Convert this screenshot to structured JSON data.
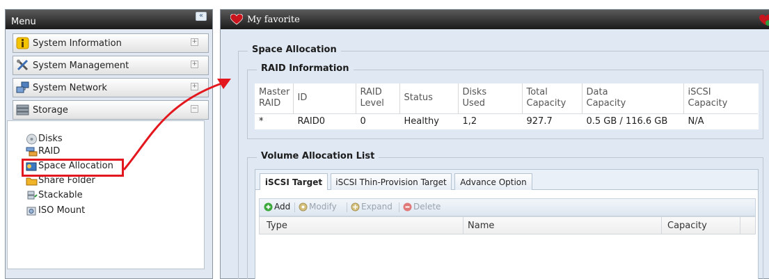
{
  "menu": {
    "title": "Menu",
    "collapse_glyph": "«",
    "categories": [
      {
        "label": "System Information",
        "toggle": "+",
        "icon": "info-icon"
      },
      {
        "label": "System Management",
        "toggle": "+",
        "icon": "tools-icon"
      },
      {
        "label": "System Network",
        "toggle": "+",
        "icon": "network-icon"
      },
      {
        "label": "Storage",
        "toggle": "−",
        "icon": "storage-icon"
      }
    ],
    "storage_items": [
      {
        "label": "Disks",
        "icon": "disk-icon"
      },
      {
        "label": "RAID",
        "icon": "raid-icon"
      },
      {
        "label": "Space Allocation",
        "icon": "space-allocation-icon"
      },
      {
        "label": "Share Folder",
        "icon": "folder-icon"
      },
      {
        "label": "Stackable",
        "icon": "stackable-icon"
      },
      {
        "label": "ISO Mount",
        "icon": "iso-mount-icon"
      }
    ],
    "highlighted_item": "Space Allocation",
    "highlight_color": "#e3171e"
  },
  "favorite": {
    "title": "My favorite",
    "icon": "heart-icon",
    "accent": "#c8141c"
  },
  "space_allocation": {
    "legend": "Space Allocation",
    "raid_info": {
      "legend": "RAID Information",
      "columns": [
        {
          "line1": "Master",
          "line2": "RAID"
        },
        {
          "line1": "ID",
          "line2": ""
        },
        {
          "line1": "RAID",
          "line2": "Level"
        },
        {
          "line1": "Status",
          "line2": ""
        },
        {
          "line1": "Disks",
          "line2": "Used"
        },
        {
          "line1": "Total",
          "line2": "Capacity"
        },
        {
          "line1": "Data",
          "line2": "Capacity"
        },
        {
          "line1": "iSCSI",
          "line2": "Capacity"
        }
      ],
      "rows": [
        [
          "*",
          "RAID0",
          "0",
          "Healthy",
          "1,2",
          "927.7",
          "0.5 GB / 116.6 GB",
          "N/A"
        ]
      ]
    },
    "volume_list": {
      "legend": "Volume Allocation List",
      "tabs": [
        "iSCSI Target",
        "iSCSI Thin-Provision Target",
        "Advance Option"
      ],
      "active_tab": "iSCSI Target",
      "toolbar": [
        {
          "label": "Add",
          "icon": "add-icon",
          "enabled": true
        },
        {
          "label": "Modify",
          "icon": "modify-icon",
          "enabled": false
        },
        {
          "label": "Expand",
          "icon": "expand-icon",
          "enabled": false
        },
        {
          "label": "Delete",
          "icon": "delete-icon",
          "enabled": false
        }
      ],
      "columns": [
        "Type",
        "Name",
        "Capacity"
      ],
      "rows": []
    }
  }
}
